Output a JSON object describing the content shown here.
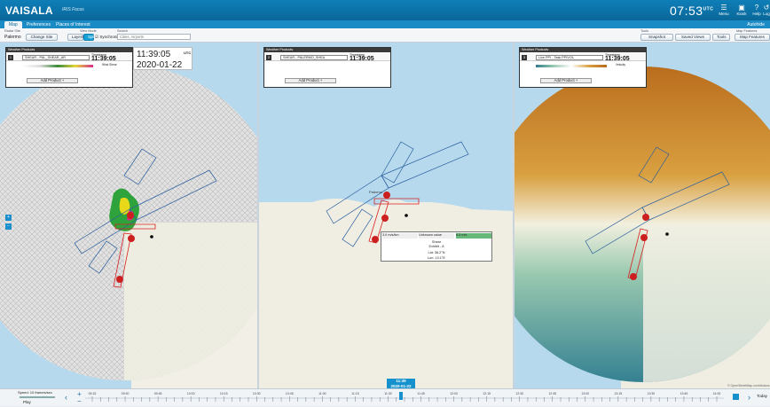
{
  "header": {
    "logo": "VAISALA",
    "app_name": "IRIS Focus",
    "clock": "07:53",
    "clock_unit": "UTC",
    "icons": [
      {
        "name": "menu-icon",
        "label": "Menu"
      },
      {
        "name": "kiosk-icon",
        "label": "Kiosk"
      },
      {
        "name": "help-icon",
        "label": "Help"
      },
      {
        "name": "logout-icon",
        "label": "Log"
      }
    ]
  },
  "tabs": [
    "Map",
    "Preferences",
    "Places of Interest"
  ],
  "autohide": "Autohide",
  "toolbar": {
    "radar_site_label": "Radar Site",
    "radar_site_value": "Palermo",
    "change_site": "Change Site",
    "view_mode_label": "View Mode",
    "layers": "Layers",
    "panels": "Split",
    "synchronize": "Synchronize Maps",
    "search_label": "Search",
    "search_placeholder": "Cities, Airports",
    "tools_label": "Tools",
    "snapshot": "Snapshot",
    "saved_views": "Saved Views",
    "tools": "Tools",
    "map_features_label": "Map Features",
    "map_features": "Map Features"
  },
  "panels": [
    {
      "header": "Weather Products",
      "help": "Help",
      "num": "1",
      "product": "SHEAR - PAL_SHEAR_AR",
      "ts_label": "Timestamp",
      "timestamp": "11:39:05",
      "legend_label": "Wind Shear",
      "add": "Add Product +"
    },
    {
      "header": "Weather Products",
      "help": "Help",
      "num": "2",
      "product": "SHEAR - PALERMO_SHEA",
      "ts_label": "Timestamp",
      "timestamp": "11:39:05",
      "legend_label": "",
      "add": "Add Product +"
    },
    {
      "header": "Weather Products",
      "help": "Help",
      "num": "3",
      "product": "Live PPI - Task PPIVOL",
      "ts_label": "Timestamp",
      "timestamp": "11:39:05",
      "legend_label": "Velocity",
      "add": "Add Product +"
    }
  ],
  "big_time": {
    "time": "11:39:05",
    "unit": "UTC",
    "date": "2020-01-22"
  },
  "popup": {
    "v1": "3.0 m/s/km",
    "v2": "Unknown value",
    "v3": "6.5 m/s",
    "title": "Shear",
    "subtitle": "Exhibit - 8",
    "lat": "Lat: 38.2°N",
    "lon": "Lon: 13.1°E"
  },
  "box_labels": [
    "07_06R",
    "07_06R",
    "07_06R",
    "25_06R",
    "07_06R",
    "07_06R",
    "07_06R",
    "25_06R",
    "07_06R"
  ],
  "place_label": "Palermo",
  "attribution": "© OpenStreetMap contributors",
  "timeline": {
    "speed": "Speed: 10 frames/sec",
    "play": "Play",
    "today": "Today",
    "time": "11:39",
    "date": "2020-01-22",
    "ticks": [
      "09:15",
      "09:30",
      "09:45",
      "10:00",
      "10:15",
      "10:30",
      "10:45",
      "11:00",
      "11:15",
      "11:30",
      "11:45",
      "12:00",
      "12:15",
      "12:30",
      "12:45",
      "13:00",
      "13:15",
      "13:30",
      "13:45",
      "14:00"
    ]
  }
}
